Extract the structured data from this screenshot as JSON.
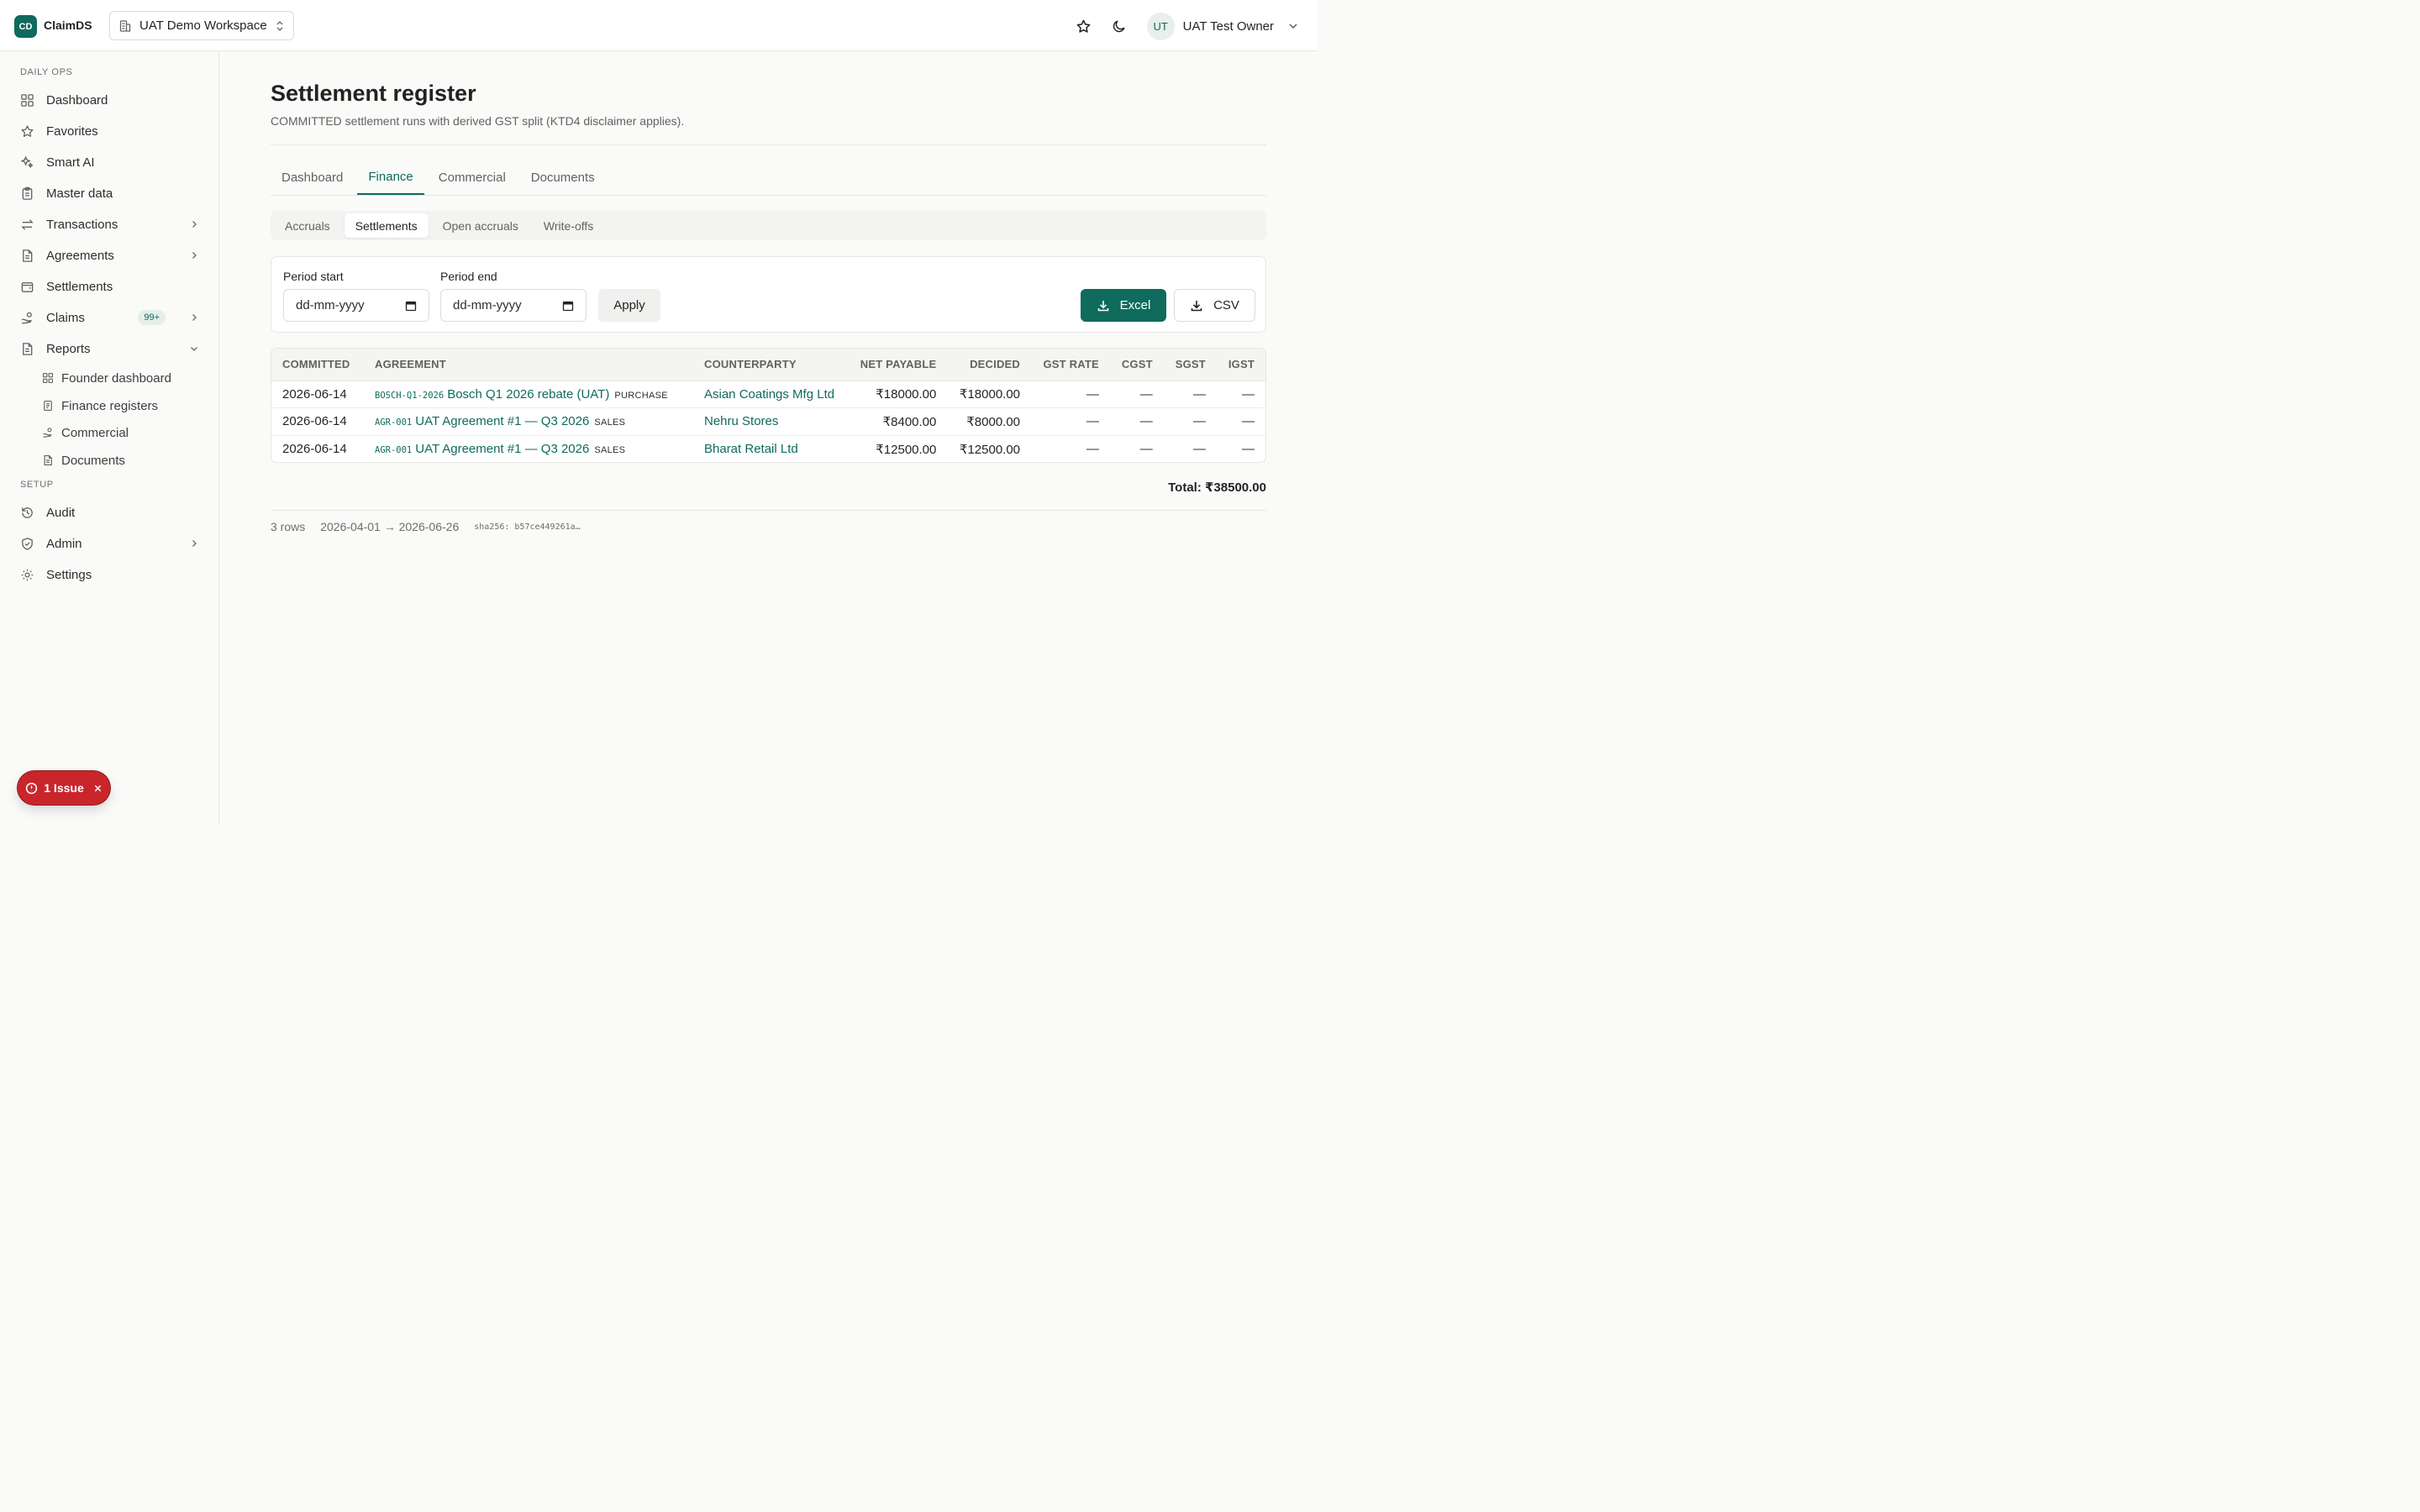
{
  "app": {
    "logo_initials": "CD",
    "name": "ClaimDS"
  },
  "workspace": {
    "label": "UAT Demo Workspace"
  },
  "user": {
    "initials": "UT",
    "name": "UAT Test Owner"
  },
  "sidebar": {
    "daily_ops_label": "DAILY OPS",
    "setup_label": "SETUP",
    "items": [
      {
        "label": "Dashboard"
      },
      {
        "label": "Favorites"
      },
      {
        "label": "Smart AI"
      },
      {
        "label": "Master data"
      },
      {
        "label": "Transactions"
      },
      {
        "label": "Agreements"
      },
      {
        "label": "Settlements"
      },
      {
        "label": "Claims",
        "badge": "99+"
      },
      {
        "label": "Reports"
      }
    ],
    "report_subitems": [
      {
        "label": "Founder dashboard"
      },
      {
        "label": "Finance registers"
      },
      {
        "label": "Commercial"
      },
      {
        "label": "Documents"
      }
    ],
    "setup_items": [
      {
        "label": "Audit"
      },
      {
        "label": "Admin"
      },
      {
        "label": "Settings"
      }
    ]
  },
  "page": {
    "title": "Settlement register",
    "subtitle": "COMMITTED settlement runs with derived GST split (KTD4 disclaimer applies)."
  },
  "tabs": [
    "Dashboard",
    "Finance",
    "Commercial",
    "Documents"
  ],
  "subtabs": [
    "Accruals",
    "Settlements",
    "Open accruals",
    "Write-offs"
  ],
  "filters": {
    "period_start_label": "Period start",
    "period_end_label": "Period end",
    "date_placeholder": "dd-mm-yyyy",
    "apply_label": "Apply",
    "excel_label": "Excel",
    "csv_label": "CSV"
  },
  "table": {
    "headers": [
      "COMMITTED",
      "AGREEMENT",
      "COUNTERPARTY",
      "NET PAYABLE",
      "DECIDED",
      "GST RATE",
      "CGST",
      "SGST",
      "IGST"
    ],
    "rows": [
      {
        "committed": "2026-06-14",
        "code": "BOSCH-Q1-2026",
        "agreement": "Bosch Q1 2026 rebate (UAT)",
        "type": "PURCHASE",
        "counterparty": "Asian Coatings Mfg Ltd",
        "net_payable": "₹18000.00",
        "decided": "₹18000.00",
        "gst_rate": "—",
        "cgst": "—",
        "sgst": "—",
        "igst": "—"
      },
      {
        "committed": "2026-06-14",
        "code": "AGR-001",
        "agreement": "UAT Agreement #1 — Q3 2026",
        "type": "SALES",
        "counterparty": "Nehru Stores",
        "net_payable": "₹8400.00",
        "decided": "₹8000.00",
        "gst_rate": "—",
        "cgst": "—",
        "sgst": "—",
        "igst": "—"
      },
      {
        "committed": "2026-06-14",
        "code": "AGR-001",
        "agreement": "UAT Agreement #1 — Q3 2026",
        "type": "SALES",
        "counterparty": "Bharat Retail Ltd",
        "net_payable": "₹12500.00",
        "decided": "₹12500.00",
        "gst_rate": "—",
        "cgst": "—",
        "sgst": "—",
        "igst": "—"
      }
    ],
    "total": "Total: ₹38500.00"
  },
  "footer": {
    "rows": "3 rows",
    "range": "2026-04-01 → 2026-06-26",
    "hash": "sha256: b57ce449261a…"
  },
  "issue": {
    "label": "1 Issue"
  },
  "colors": {
    "accent": "#0f6b5c",
    "danger": "#c9262c"
  }
}
